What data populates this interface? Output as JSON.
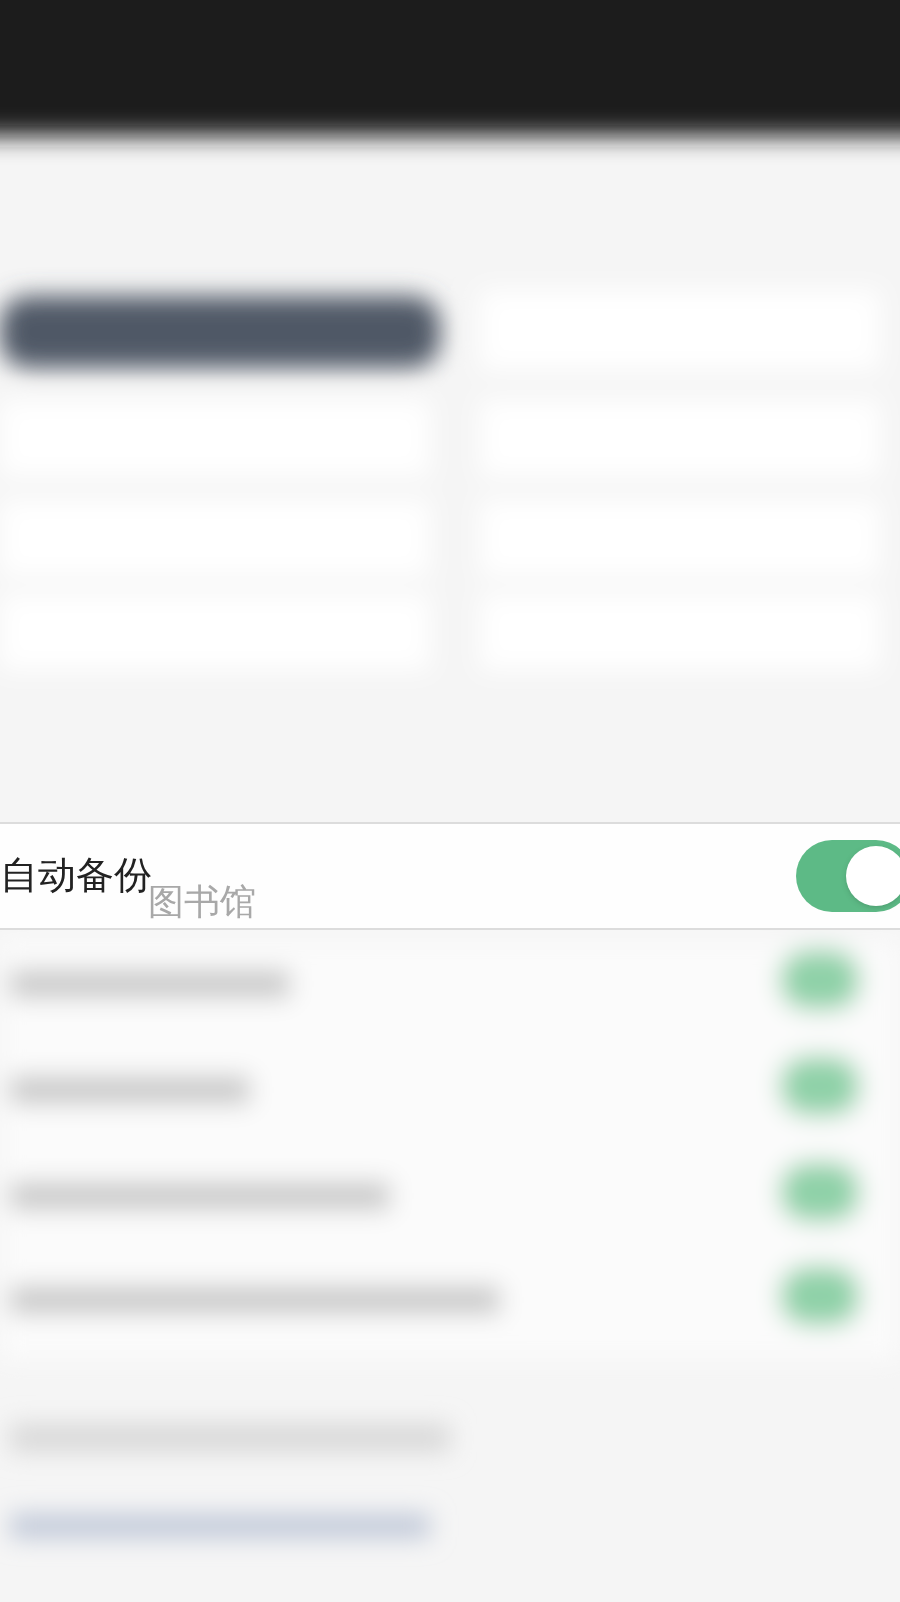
{
  "setting": {
    "label": "自动备份",
    "on": true
  },
  "background_label": "图书馆"
}
